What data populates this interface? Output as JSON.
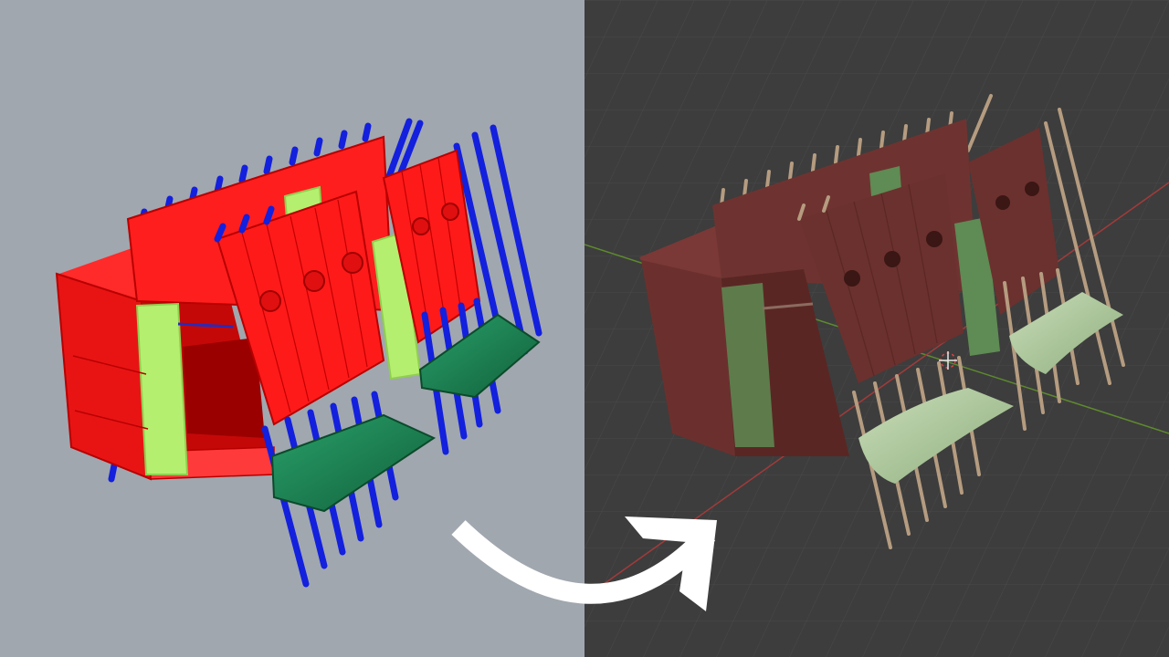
{
  "left_view": {
    "background": "#a0a7af",
    "colors": {
      "shell": "#ff1a1a",
      "wire": "#b80000",
      "panel_green": "#b5ef6f",
      "ramp": "#1d7f4e",
      "posts": "#1320dd"
    }
  },
  "right_view": {
    "background": "#3d3d3d",
    "colors": {
      "shell": "#6e3330",
      "panel_green": "#5f8b54",
      "ramp": "#a9c79a",
      "posts": "#b59c80",
      "axis_x": "#a33a3a",
      "axis_y": "#5e8a2e"
    }
  },
  "transition_arrow": {
    "icon": "curved-arrow-icon",
    "color": "#ffffff"
  }
}
